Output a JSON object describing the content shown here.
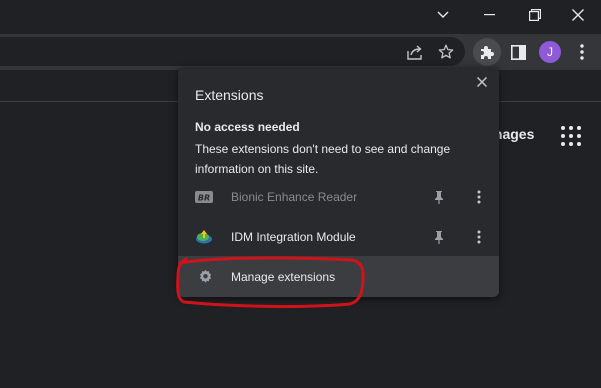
{
  "titlebar": {
    "controls": [
      {
        "icon": "chevron-down-icon"
      },
      {
        "icon": "minimize-icon"
      },
      {
        "icon": "restore-icon"
      },
      {
        "icon": "close-icon"
      }
    ]
  },
  "toolbar": {
    "icons": [
      "share-icon",
      "star-icon",
      "extensions-puzzle-icon",
      "side-panel-icon",
      "more-vert-icon"
    ],
    "avatar_letter": "J",
    "avatar_color": "#8e5ad8"
  },
  "content": {
    "images_link": "mages"
  },
  "extensions_popup": {
    "title": "Extensions",
    "section_heading": "No access needed",
    "section_description": "These extensions don't need to see and change information on this site.",
    "items": [
      {
        "name": "Bionic Enhance Reader",
        "icon": "bionic-reader-icon",
        "enabled": false
      },
      {
        "name": "IDM Integration Module",
        "icon": "idm-icon",
        "enabled": true
      }
    ],
    "manage_label": "Manage extensions"
  },
  "annotation": {
    "color": "#d0121b"
  }
}
